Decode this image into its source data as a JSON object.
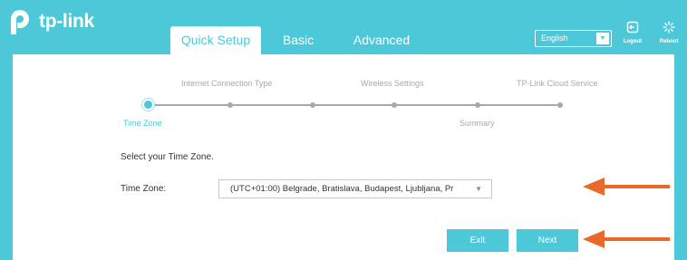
{
  "brand": {
    "name": "tp-link"
  },
  "tabs": [
    {
      "label": "Quick Setup",
      "active": true
    },
    {
      "label": "Basic",
      "active": false
    },
    {
      "label": "Advanced",
      "active": false
    }
  ],
  "header": {
    "language": "English",
    "logout_label": "Logout",
    "reboot_label": "Reboot"
  },
  "stepper": {
    "steps": [
      "Time Zone",
      "Internet Connection Type",
      "Wireless Settings",
      "Summary",
      "TP-Link Cloud Service"
    ],
    "current": "Time Zone"
  },
  "form": {
    "instruction": "Select your Time Zone.",
    "time_zone_label": "Time Zone:",
    "time_zone_value": "(UTC+01:00) Belgrade, Bratislava, Budapest, Ljubljana, Pr"
  },
  "actions": {
    "exit_label": "Exit",
    "next_label": "Next"
  },
  "colors": {
    "brand": "#4dc8d9",
    "annotation_arrow": "#e8692a"
  },
  "icons": [
    "tp-link-logo-icon",
    "logout-icon",
    "reboot-icon",
    "chevron-down-icon",
    "arrow-left-icon"
  ]
}
